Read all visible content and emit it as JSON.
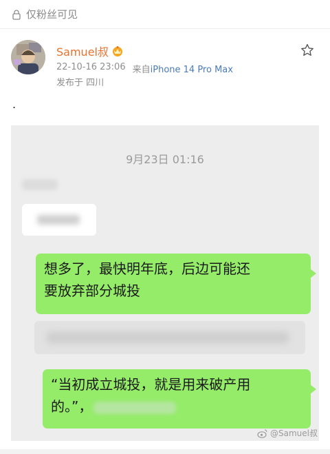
{
  "header": {
    "visibility_icon": "lock-icon",
    "visibility_label": "仅粉丝可见"
  },
  "author": {
    "name": "Samuel叔",
    "badge_icon": "vip-crown-icon",
    "timestamp": "22-10-16 23:06",
    "source_prefix": "来自",
    "device": "iPhone 14 Pro Max",
    "location": "发布于 四川",
    "favorite_icon": "star-icon"
  },
  "post": {
    "text": "."
  },
  "chat_screenshot": {
    "time": "9月23日 01:16",
    "outgoing_1_line1": "想多了，最快明年底，后边可能还",
    "outgoing_1_line2": "要放弃部分城投",
    "outgoing_2_line1": "“当初成立城投，就是用来破产用",
    "outgoing_2_line2": "的。”，",
    "bubble_color": "#95ec69",
    "background_color": "#ededed"
  },
  "watermark": {
    "text": "@Samuel叔",
    "icon": "weibo-icon"
  }
}
